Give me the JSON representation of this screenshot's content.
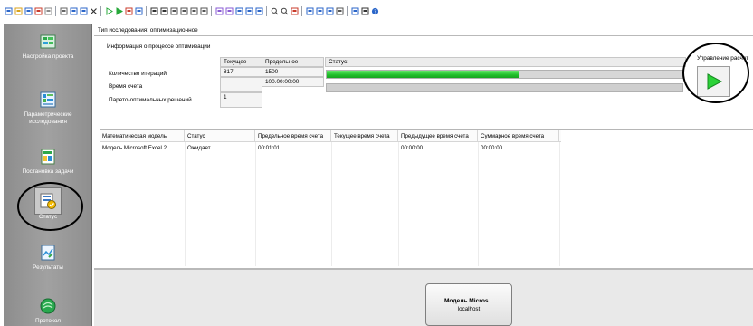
{
  "toolbar": {
    "icons": [
      "new-icon",
      "open-icon",
      "save-icon",
      "chart-icon",
      "properties-icon",
      "cut-icon",
      "copy-icon",
      "paste-icon",
      "delete-icon",
      "play-outline-icon",
      "play-icon",
      "stop-icon",
      "refresh-icon",
      "sort-asc-icon",
      "sort-desc-icon",
      "first-icon",
      "last-icon",
      "prev-icon",
      "next-icon",
      "split-icon",
      "merge-icon",
      "graph-icon",
      "chart2-icon",
      "tree-icon",
      "zoom-in-icon",
      "zoom-out-icon",
      "report-icon",
      "line-chart-icon",
      "bar-chart-icon",
      "list-icon",
      "table-icon",
      "export-icon",
      "filter-icon",
      "help-icon"
    ]
  },
  "sidebar": {
    "items": [
      {
        "label": "Настройка проекта",
        "icon": "project-settings-icon"
      },
      {
        "label": "Параметрические исследования",
        "icon": "parametric-study-icon"
      },
      {
        "label": "Постановка задачи",
        "icon": "problem-setup-icon"
      },
      {
        "label": "Статус",
        "icon": "status-icon"
      },
      {
        "label": "Результаты",
        "icon": "results-icon"
      },
      {
        "label": "Протокол",
        "icon": "protocol-icon"
      }
    ]
  },
  "main": {
    "study_type": "Тип исследования: оптимизационное",
    "info_title": "Информация о процессе оптимизации",
    "col_current": "Текущее",
    "col_limit": "Предельное",
    "col_status": "Статус:",
    "rows": [
      {
        "label": "Количество итераций",
        "current": "817",
        "limit": "1500"
      },
      {
        "label": "Время счета",
        "current": "",
        "limit": "100.00:00:00"
      },
      {
        "label": "Парето-оптимальных решений",
        "current": "1",
        "limit": ""
      }
    ],
    "progress_percent": 54,
    "control_label": "Управление расчет",
    "accent": "#22b12c"
  },
  "table": {
    "headers": [
      "Математическая модель",
      "Статус",
      "Предельное время счета",
      "Текущее время счета",
      "Предыдущее время счета",
      "Суммарное время счета"
    ],
    "rows": [
      [
        "Модель Microsoft Excel 2...",
        "Ожидает",
        "00:01:01",
        "",
        "00:00:00",
        "00:00:00"
      ]
    ]
  },
  "bottom": {
    "node_title": "Модель Micros...",
    "node_host": "localhost"
  }
}
